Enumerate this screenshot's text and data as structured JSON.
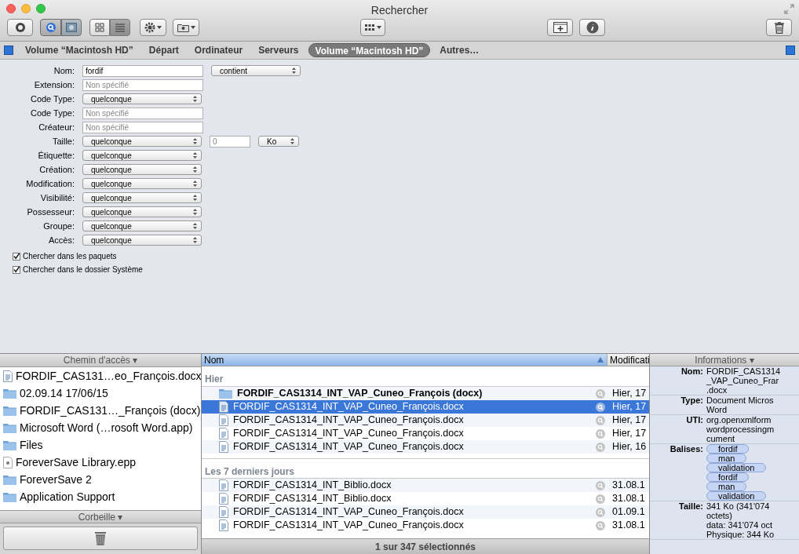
{
  "window": {
    "title": "Rechercher"
  },
  "toolbar": {
    "view_buttons": [
      {
        "selected": false
      },
      {
        "selected": true
      }
    ]
  },
  "scope_tabs": [
    {
      "label": "Volume “Macintosh HD”",
      "selected": false
    },
    {
      "label": "Départ",
      "selected": false
    },
    {
      "label": "Ordinateur",
      "selected": false
    },
    {
      "label": "Serveurs",
      "selected": false
    },
    {
      "label": "Volume “Macintosh HD”",
      "selected": true
    },
    {
      "label": "Autres…",
      "selected": false
    }
  ],
  "criteria": [
    {
      "label": "Nom:",
      "controls": [
        {
          "kind": "text",
          "value": "fordif"
        },
        {
          "kind": "popup",
          "value": "contient"
        }
      ]
    },
    {
      "label": "Extension:",
      "controls": [
        {
          "kind": "text",
          "placeholder": "Non spécifié"
        }
      ]
    },
    {
      "label": "Code Type:",
      "controls": [
        {
          "kind": "popup",
          "value": "quelconque"
        }
      ]
    },
    {
      "label": "Code Type:",
      "controls": [
        {
          "kind": "text",
          "placeholder": "Non spécifié"
        }
      ]
    },
    {
      "label": "Créateur:",
      "controls": [
        {
          "kind": "text",
          "placeholder": "Non spécifié"
        }
      ]
    },
    {
      "label": "Taille:",
      "controls": [
        {
          "kind": "popup",
          "value": "quelconque"
        },
        {
          "kind": "number",
          "placeholder": "0"
        },
        {
          "kind": "unit",
          "value": "Ko"
        }
      ]
    },
    {
      "label": "Étiquette:",
      "controls": [
        {
          "kind": "popup",
          "value": "quelconque"
        }
      ]
    },
    {
      "label": "Création:",
      "controls": [
        {
          "kind": "popup",
          "value": "quelconque"
        }
      ]
    },
    {
      "label": "Modification:",
      "controls": [
        {
          "kind": "popup",
          "value": "quelconque"
        }
      ]
    },
    {
      "label": "Visibilité:",
      "controls": [
        {
          "kind": "popup",
          "value": "quelconque"
        }
      ]
    },
    {
      "label": "Possesseur:",
      "controls": [
        {
          "kind": "popup",
          "value": "quelconque"
        }
      ]
    },
    {
      "label": "Groupe:",
      "controls": [
        {
          "kind": "popup",
          "value": "quelconque"
        }
      ]
    },
    {
      "label": "Accès:",
      "controls": [
        {
          "kind": "popup",
          "value": "quelconque"
        }
      ]
    }
  ],
  "options": [
    {
      "label": "Chercher dans les paquets",
      "checked": true
    },
    {
      "label": "Chercher dans le dossier Système",
      "checked": true
    }
  ],
  "path_panel": {
    "header": "Chemin d'accès ▾",
    "items": [
      {
        "kind": "document",
        "label": "FORDIF_CAS131…eo_François.docx"
      },
      {
        "kind": "folder",
        "label": "02.09.14 17/06/15"
      },
      {
        "kind": "folder",
        "label": "FORDIF_CAS131…_François (docx)"
      },
      {
        "kind": "folder",
        "label": "Microsoft Word (…rosoft Word.app)"
      },
      {
        "kind": "folder",
        "label": "Files"
      },
      {
        "kind": "file",
        "label": "ForeverSave Library.epp"
      },
      {
        "kind": "folder",
        "label": "ForeverSave 2"
      },
      {
        "kind": "folder",
        "label": "Application Support"
      }
    ],
    "trash_header": "Corbeille ▾"
  },
  "results": {
    "columns": [
      "Nom",
      "Modificati"
    ],
    "groups": [
      {
        "header": "Hier",
        "rows": [
          {
            "kind": "folder",
            "name": "FORDIF_CAS1314_INT_VAP_Cuneo_François (docx)",
            "modified": "Hier, 17",
            "selected": false
          },
          {
            "kind": "document",
            "name": "FORDIF_CAS1314_INT_VAP_Cuneo_François.docx",
            "modified": "Hier, 17",
            "selected": true
          },
          {
            "kind": "document",
            "name": "FORDIF_CAS1314_INT_VAP_Cuneo_François.docx",
            "modified": "Hier, 17",
            "selected": false
          },
          {
            "kind": "document",
            "name": "FORDIF_CAS1314_INT_VAP_Cuneo_François.docx",
            "modified": "Hier, 17",
            "selected": false
          },
          {
            "kind": "document",
            "name": "FORDIF_CAS1314_INT_VAP_Cuneo_François.docx",
            "modified": "Hier, 16",
            "selected": false
          }
        ]
      },
      {
        "header": "Les 7 derniers jours",
        "rows": [
          {
            "kind": "document",
            "name": "FORDIF_CAS1314_INT_Biblio.docx",
            "modified": "31.08.1",
            "selected": false
          },
          {
            "kind": "document",
            "name": "FORDIF_CAS1314_INT_Biblio.docx",
            "modified": "31.08.1",
            "selected": false
          },
          {
            "kind": "document",
            "name": "FORDIF_CAS1314_INT_VAP_Cuneo_François.docx",
            "modified": "01.09.1",
            "selected": false
          },
          {
            "kind": "document",
            "name": "FORDIF_CAS1314_INT_VAP_Cuneo_François.docx",
            "modified": "31.08.1",
            "selected": false
          }
        ]
      }
    ],
    "status": "1 sur 347 sélectionnés"
  },
  "info_panel": {
    "header": "Informations ▾",
    "fields": [
      {
        "label": "Nom:",
        "lines": [
          "FORDIF_CAS1314",
          "_VAP_Cuneo_Frar",
          ".docx"
        ]
      },
      {
        "label": "Type:",
        "lines": [
          "Document Micros",
          "Word"
        ]
      },
      {
        "label": "UTI:",
        "lines": [
          "org.openxmlform",
          "wordprocessingm",
          "cument"
        ]
      },
      {
        "label": "Balises:",
        "tags": [
          "fordif",
          "man",
          "validation",
          "fordif",
          "man",
          "validation"
        ]
      },
      {
        "label": "Taille:",
        "lines": [
          "341 Ko (341'074",
          "octets)",
          "data: 341'074 oct",
          "Physique: 344 Ko"
        ]
      }
    ]
  }
}
